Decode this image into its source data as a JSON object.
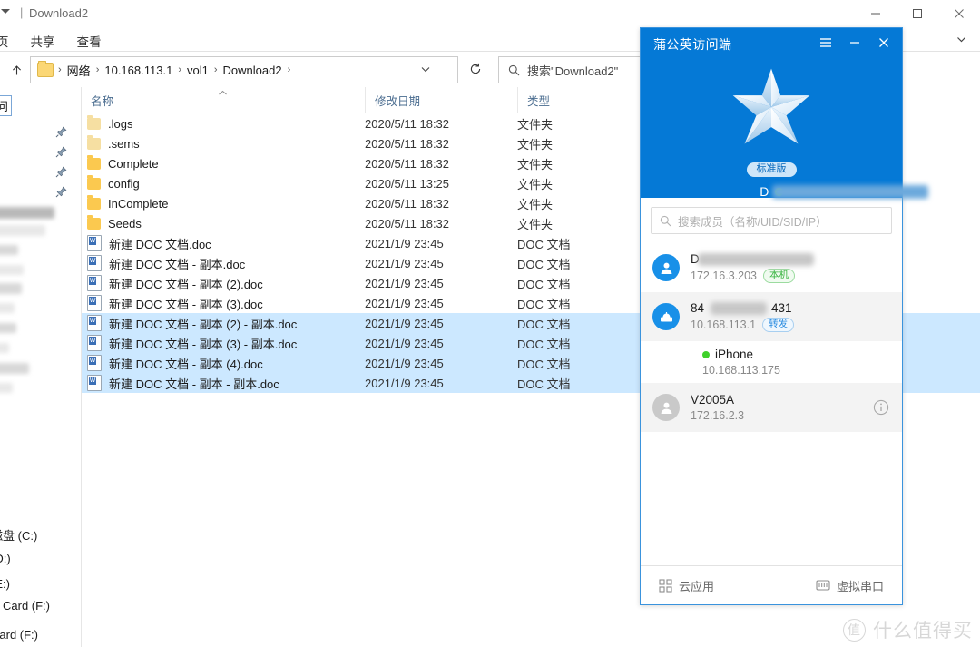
{
  "window": {
    "title": "Download2",
    "qat_icon": "caret-down-icon",
    "separator": "|",
    "minimize": "−",
    "maximize": "□",
    "close": "✕"
  },
  "ribbon": {
    "tabs": [
      "页",
      "共享",
      "查看"
    ],
    "collapse_icon": "chevron-down-icon"
  },
  "address": {
    "up_icon": "arrow-up-icon",
    "folder_icon": "folder-icon",
    "crumbs": [
      "网络",
      "10.168.113.1",
      "vol1",
      "Download2"
    ],
    "separator": "›",
    "dropdown_icon": "chevron-down-icon",
    "refresh_icon": "refresh-icon"
  },
  "search": {
    "icon": "search-icon",
    "placeholder": "搜索\"Download2\""
  },
  "navpane": {
    "quick_access_label": "问",
    "drives": [
      "磁盘 (C:)",
      "(D:)",
      "(E:)",
      "C Card (F:)",
      "Card (F:)"
    ]
  },
  "filelist": {
    "columns": [
      {
        "label": "名称",
        "sorted": true,
        "sort_icon": "chevron-up-icon"
      },
      {
        "label": "修改日期",
        "sorted": false
      },
      {
        "label": "类型",
        "sorted": false
      }
    ],
    "rows": [
      {
        "name": ".logs",
        "date": "2020/5/11 18:32",
        "type": "文件夹",
        "icon": "folder-icon",
        "selected": false
      },
      {
        "name": ".sems",
        "date": "2020/5/11 18:32",
        "type": "文件夹",
        "icon": "folder-icon",
        "selected": false
      },
      {
        "name": "Complete",
        "date": "2020/5/11 18:32",
        "type": "文件夹",
        "icon": "folder-icon",
        "selected": false
      },
      {
        "name": "config",
        "date": "2020/5/11 13:25",
        "type": "文件夹",
        "icon": "folder-icon",
        "selected": false
      },
      {
        "name": "InComplete",
        "date": "2020/5/11 18:32",
        "type": "文件夹",
        "icon": "folder-icon",
        "selected": false
      },
      {
        "name": "Seeds",
        "date": "2020/5/11 18:32",
        "type": "文件夹",
        "icon": "folder-icon",
        "selected": false
      },
      {
        "name": "新建 DOC 文档.doc",
        "date": "2021/1/9 23:45",
        "type": "DOC 文档",
        "icon": "doc-file-icon",
        "selected": false
      },
      {
        "name": "新建 DOC 文档 - 副本.doc",
        "date": "2021/1/9 23:45",
        "type": "DOC 文档",
        "icon": "doc-file-icon",
        "selected": false
      },
      {
        "name": "新建 DOC 文档 - 副本 (2).doc",
        "date": "2021/1/9 23:45",
        "type": "DOC 文档",
        "icon": "doc-file-icon",
        "selected": false
      },
      {
        "name": "新建 DOC 文档 - 副本 (3).doc",
        "date": "2021/1/9 23:45",
        "type": "DOC 文档",
        "icon": "doc-file-icon",
        "selected": false
      },
      {
        "name": "新建 DOC 文档 - 副本 (2) - 副本.doc",
        "date": "2021/1/9 23:45",
        "type": "DOC 文档",
        "icon": "doc-file-icon",
        "selected": true
      },
      {
        "name": "新建 DOC 文档 - 副本 (3) - 副本.doc",
        "date": "2021/1/9 23:45",
        "type": "DOC 文档",
        "icon": "doc-file-icon",
        "selected": true
      },
      {
        "name": "新建 DOC 文档 - 副本 (4).doc",
        "date": "2021/1/9 23:45",
        "type": "DOC 文档",
        "icon": "doc-file-icon",
        "selected": true
      },
      {
        "name": "新建 DOC 文档 - 副本 - 副本.doc",
        "date": "2021/1/9 23:45",
        "type": "DOC 文档",
        "icon": "doc-file-icon",
        "selected": true
      }
    ]
  },
  "vpn": {
    "title": "蒲公英访问端",
    "menu_icon": "hamburger-icon",
    "minimize_icon": "minimize-icon",
    "close_icon": "close-icon",
    "logo_icon": "star-icon",
    "edition_badge": "标准版",
    "device_name": "D",
    "device_online": true,
    "header_color": "#0579d6",
    "search": {
      "icon": "search-icon",
      "placeholder": "搜索成员（名称/UID/SID/IP）"
    },
    "members": [
      {
        "name": "D",
        "redacted": true,
        "ip": "172.16.3.203",
        "tag": "本机",
        "tag_kind": "local",
        "avatar": "person-icon",
        "avatar_style": "blue",
        "alt": false,
        "indent": false,
        "online_dot": false,
        "info": false
      },
      {
        "name": "84",
        "name_suffix": "431",
        "redacted": true,
        "ip": "10.168.113.1",
        "tag": "转发",
        "tag_kind": "fwd",
        "avatar": "router-icon",
        "avatar_style": "blue",
        "alt": true,
        "indent": false,
        "online_dot": false,
        "info": false
      },
      {
        "name": "iPhone",
        "redacted": false,
        "ip": "10.168.113.175",
        "tag": "",
        "tag_kind": "",
        "avatar": "",
        "avatar_style": "none",
        "alt": false,
        "indent": true,
        "online_dot": true,
        "info": false
      },
      {
        "name": "V2005A",
        "redacted": false,
        "ip": "172.16.2.3",
        "tag": "",
        "tag_kind": "",
        "avatar": "person-icon",
        "avatar_style": "grey",
        "alt": true,
        "indent": false,
        "online_dot": false,
        "info": true
      }
    ],
    "footer": {
      "cloud_apps_icon": "grid-apps-icon",
      "cloud_apps_label": "云应用",
      "serial_icon": "serial-port-icon",
      "serial_label": "虚拟串口"
    }
  },
  "watermark": {
    "mark": "值",
    "text": "什么值得买"
  }
}
